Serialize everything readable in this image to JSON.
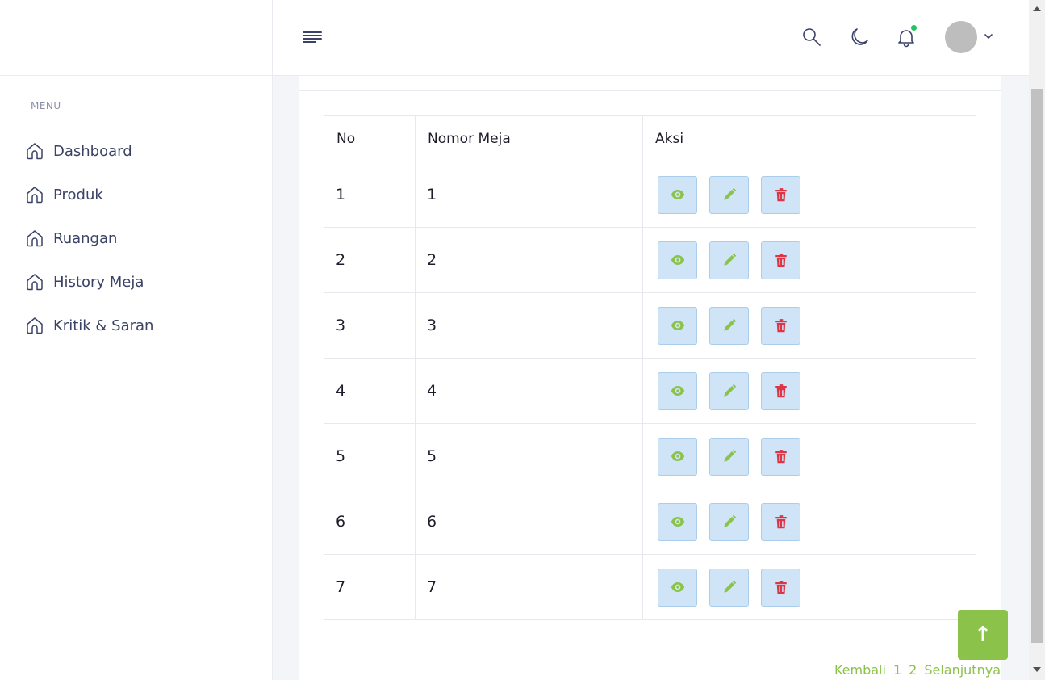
{
  "sidebar": {
    "menu_label": "MENU",
    "items": [
      {
        "label": "Dashboard",
        "icon": "home-icon"
      },
      {
        "label": "Produk",
        "icon": "home-icon"
      },
      {
        "label": "Ruangan",
        "icon": "home-icon"
      },
      {
        "label": "History Meja",
        "icon": "home-icon"
      },
      {
        "label": "Kritik & Saran",
        "icon": "home-icon"
      }
    ]
  },
  "header": {
    "icons": [
      "menu-icon",
      "search-icon",
      "moon-icon",
      "bell-icon",
      "chevron-down-icon"
    ],
    "notification_color": "#22c55e"
  },
  "table": {
    "headers": [
      "No",
      "Nomor Meja",
      "Aksi"
    ],
    "rows": [
      {
        "no": "1",
        "meja": "1"
      },
      {
        "no": "2",
        "meja": "2"
      },
      {
        "no": "3",
        "meja": "3"
      },
      {
        "no": "4",
        "meja": "4"
      },
      {
        "no": "5",
        "meja": "5"
      },
      {
        "no": "6",
        "meja": "6"
      },
      {
        "no": "7",
        "meja": "7"
      }
    ],
    "action_icons": [
      "eye-icon",
      "pencil-icon",
      "trash-icon"
    ]
  },
  "pagination": {
    "prev": "Kembali",
    "pages": [
      "1",
      "2"
    ],
    "next": "Selanjutnya"
  },
  "back_to_top": {
    "label": "↑",
    "icon": "arrow-up-icon"
  },
  "colors": {
    "accent": "#8bc34a",
    "danger": "#dc3545",
    "button_bg": "#cfe5f7",
    "nav_text": "#3a4266"
  }
}
